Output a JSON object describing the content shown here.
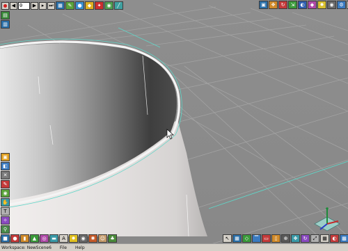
{
  "timeline": {
    "frame_value": "0"
  },
  "status": {
    "workspace_label": "Workspace: NewScene6",
    "menu": [
      "File",
      "Help"
    ]
  },
  "colors": {
    "floor": "#8c8c8c",
    "grid_line": "#a3a3a3",
    "axis_line": "#5fd6c8",
    "cylinder_light": "#e2dedd",
    "cylinder_dark": "#454545",
    "toolbar_bg": "#d4d0c8"
  },
  "icons": {
    "top_left": [
      "record-icon",
      "rewind-icon",
      "play-icon",
      "forward-icon",
      "end-icon",
      "grid-icon",
      "edit-icon",
      "render-icon",
      "material-icon",
      "light-icon",
      "camera-icon",
      "brush-icon"
    ],
    "top_right": [
      "select-icon",
      "move-icon",
      "rotate-icon",
      "scale-icon",
      "render-view-icon",
      "material-editor-icon",
      "light-editor-icon",
      "camera-editor-icon",
      "settings-icon",
      "help-icon"
    ],
    "left_side": [
      "scene-icon",
      "object-icon",
      "shape-icon",
      "paint-icon",
      "eye-icon",
      "hand-icon",
      "text-icon",
      "effects-icon",
      "bones-icon",
      "globe-icon"
    ],
    "bottom_left": [
      "cube-icon",
      "sphere-icon",
      "cylinder-icon",
      "cone-icon",
      "torus-icon",
      "plane-icon",
      "text-object-icon",
      "light-object-icon",
      "camera-object-icon",
      "particle-icon",
      "human-icon",
      "tree-icon"
    ],
    "bottom_right": [
      "pointer-icon",
      "grid-snap-icon",
      "perspective-icon",
      "top-view-icon",
      "front-view-icon",
      "right-view-icon",
      "zoom-icon",
      "pan-icon",
      "orbit-icon",
      "fit-icon",
      "wireframe-icon",
      "shaded-icon",
      "texture-icon"
    ]
  }
}
